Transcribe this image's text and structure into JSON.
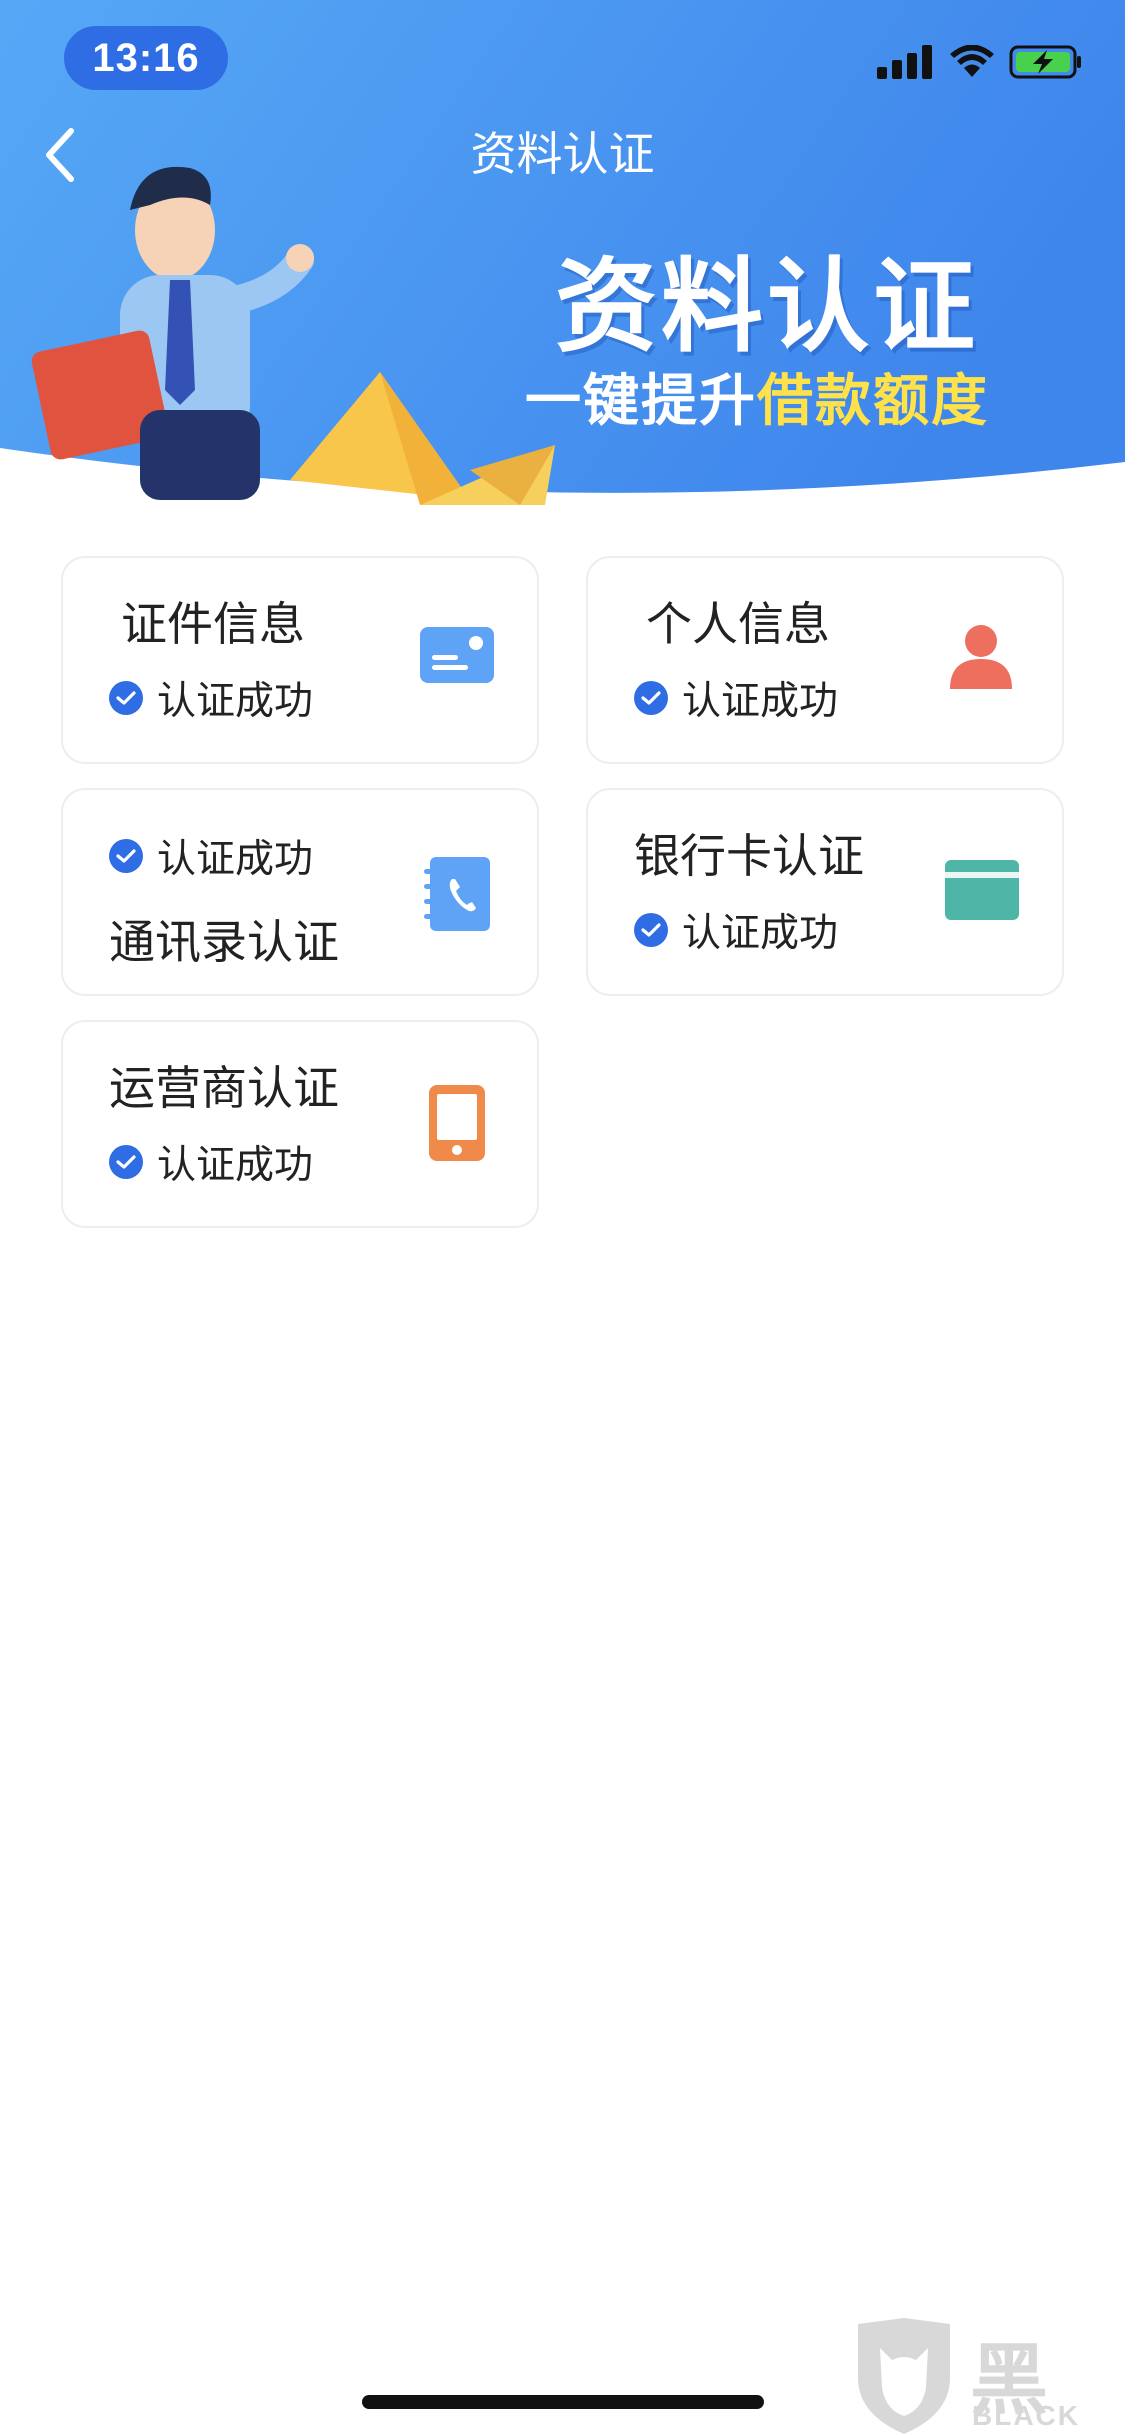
{
  "status_bar": {
    "time": "13:16"
  },
  "nav": {
    "title": "资料认证"
  },
  "banner": {
    "title": "资料认证",
    "subtitle_white": "一键提升",
    "subtitle_highlight": "借款额度"
  },
  "cards": [
    {
      "title": "证件信息",
      "status": "认证成功",
      "icon": "id-card-icon",
      "icon_color": "#5ea3f5"
    },
    {
      "title": "个人信息",
      "status": "认证成功",
      "icon": "person-icon",
      "icon_color": "#ef6f5e"
    },
    {
      "title": "通讯录认证",
      "status": "认证成功",
      "icon": "phonebook-icon",
      "icon_color": "#5ea3f5"
    },
    {
      "title": "银行卡认证",
      "status": "认证成功",
      "icon": "bank-card-icon",
      "icon_color": "#4fb5a6"
    },
    {
      "title": "运营商认证",
      "status": "认证成功",
      "icon": "mobile-phone-icon",
      "icon_color": "#f08a4b"
    }
  ],
  "watermark": {
    "brand": "黑猫",
    "brand_en": "BLACK CAT"
  },
  "colors": {
    "header_blue": "#4a98f3",
    "accent_blue": "#2f6de4",
    "highlight_yellow": "#ffe24a",
    "card_border": "#eceef3"
  }
}
